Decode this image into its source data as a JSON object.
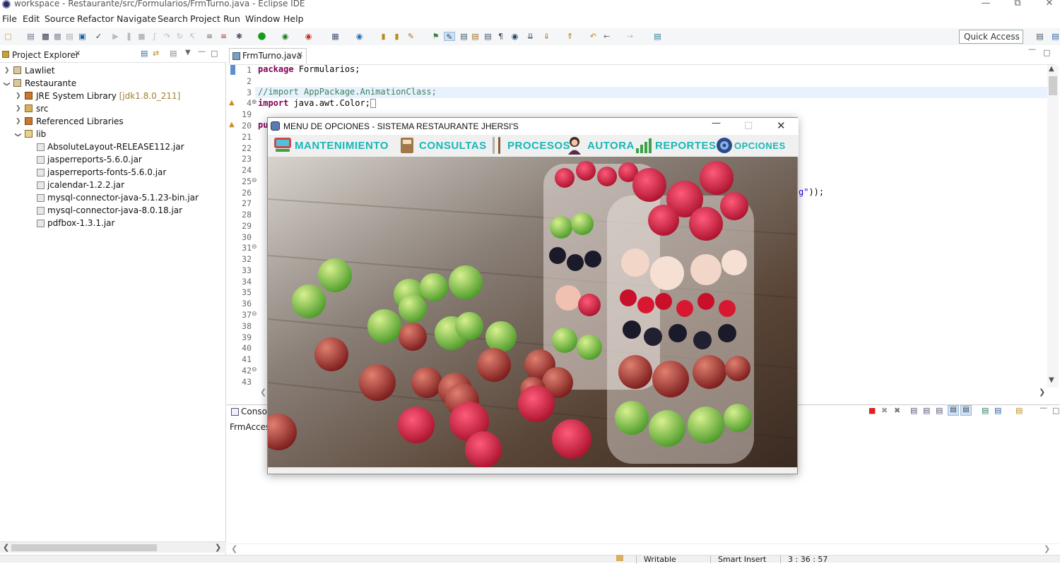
{
  "window": {
    "title": "workspace - Restaurante/src/Formularios/FrmTurno.java - Eclipse IDE"
  },
  "menubar": [
    "File",
    "Edit",
    "Source",
    "Refactor",
    "Navigate",
    "Search",
    "Project",
    "Run",
    "Window",
    "Help"
  ],
  "quick_access": "Quick Access",
  "explorer": {
    "tab": "Project Explorer",
    "items": [
      {
        "label": "Lawliet"
      },
      {
        "label": "Restaurante"
      },
      {
        "label": "JRE System Library",
        "extra": "[jdk1.8.0_211]"
      },
      {
        "label": "src"
      },
      {
        "label": "Referenced Libraries"
      },
      {
        "label": "lib"
      },
      {
        "label": "AbsoluteLayout-RELEASE112.jar"
      },
      {
        "label": "jasperreports-5.6.0.jar"
      },
      {
        "label": "jasperreports-fonts-5.6.0.jar"
      },
      {
        "label": "jcalendar-1.2.2.jar"
      },
      {
        "label": "mysql-connector-java-5.1.23-bin.jar"
      },
      {
        "label": "mysql-connector-java-8.0.18.jar"
      },
      {
        "label": "pdfbox-1.3.1.jar"
      }
    ]
  },
  "editor": {
    "tab": "FrmTurno.java",
    "line_numbers": [
      "1",
      "2",
      "3",
      "4",
      "19",
      "20",
      "21",
      "22",
      "23",
      "24",
      "25",
      "26",
      "27",
      "28",
      "29",
      "30",
      "31",
      "32",
      "33",
      "34",
      "35",
      "36",
      "37",
      "38",
      "39",
      "40",
      "41",
      "42",
      "43"
    ],
    "code_line1_kw": "package",
    "code_line1_rest": " Formularios;",
    "code_line3": "//import AppPackage.AnimationClass;",
    "code_line4_kw": "import",
    "code_line4_rest": " java.awt.Color;",
    "code_line20": "pu",
    "code_line26_tail": "g\"));"
  },
  "console": {
    "tab": "Console",
    "content": "FrmAccess"
  },
  "status": {
    "writable": "Writable",
    "insert": "Smart Insert",
    "position": "3 : 36 : 57"
  },
  "dialog": {
    "title": "MENU DE OPCIONES - SISTEMA RESTAURANTE JHERSI'S",
    "menus": [
      {
        "label": "MANTENIMIENTO",
        "icon": "computer-icon"
      },
      {
        "label": "CONSULTAS",
        "icon": "book-icon"
      },
      {
        "label": "PROCESOS",
        "icon": "utensils-icon"
      },
      {
        "label": "AUTORA",
        "icon": "woman-icon"
      },
      {
        "label": "REPORTES",
        "icon": "bar-chart-icon"
      },
      {
        "label": "OPCIONES",
        "icon": "settings-icon"
      }
    ]
  }
}
